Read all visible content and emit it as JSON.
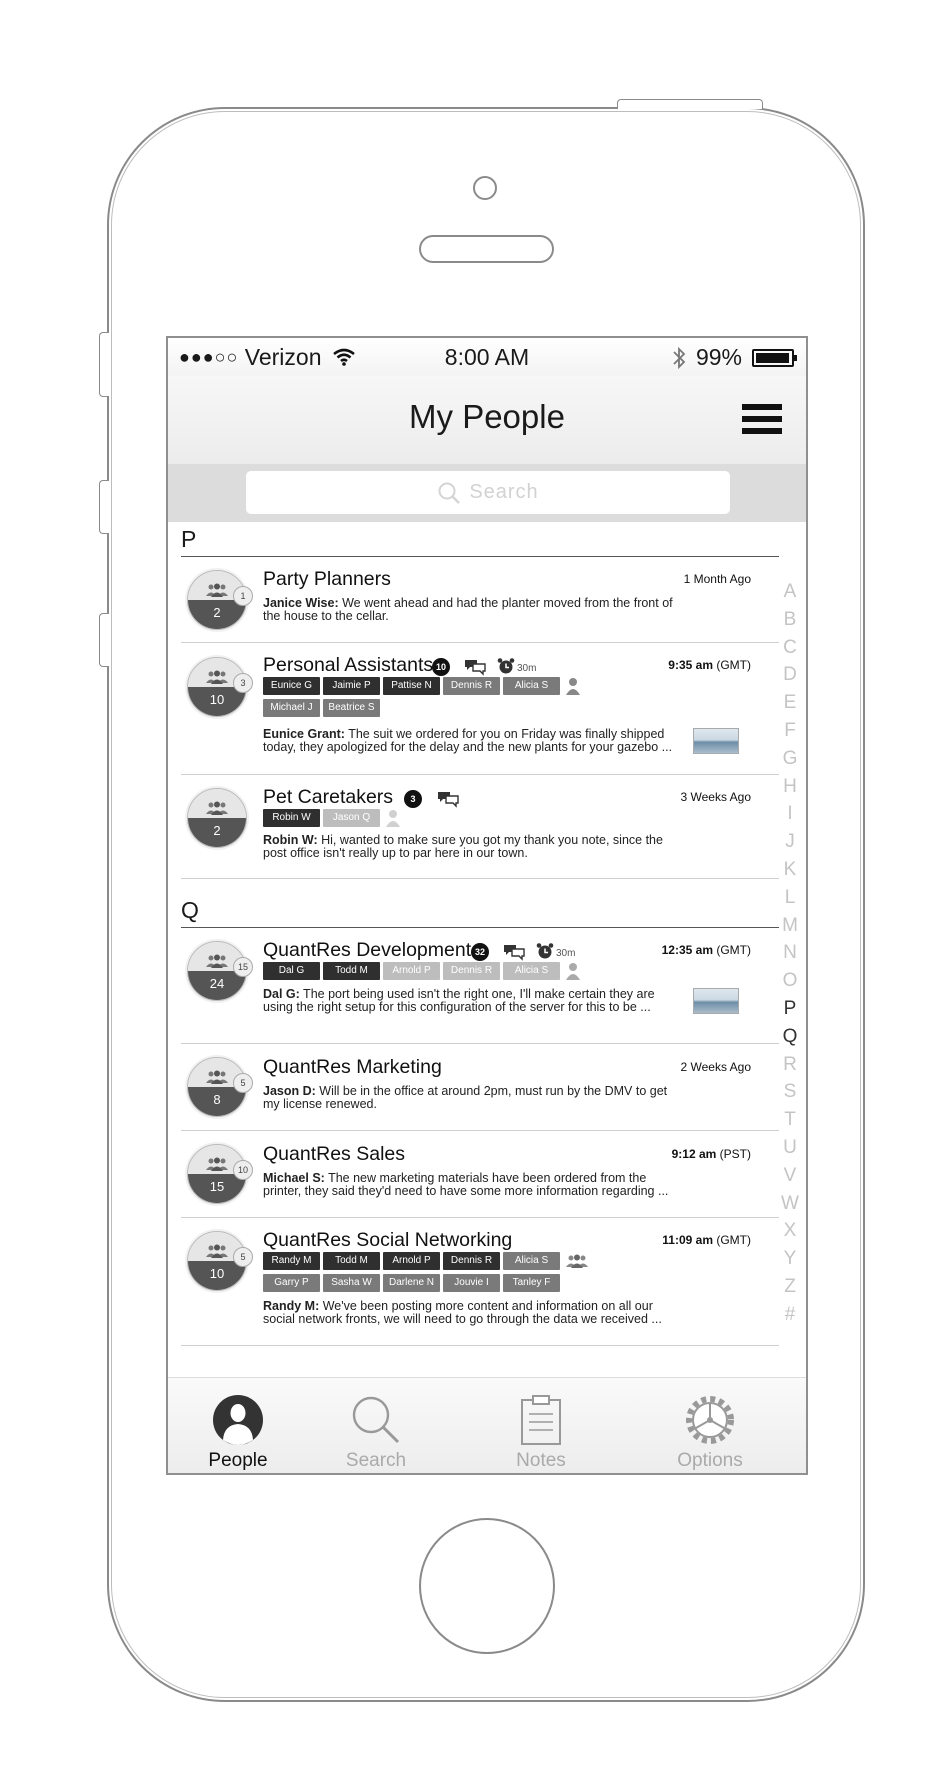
{
  "status_bar": {
    "signal": "●●●○○",
    "carrier": "Verizon",
    "time": "8:00 AM",
    "battery": "99%",
    "battery_level": 0.99
  },
  "header": {
    "title": "My People",
    "menu_icon": "hamburger-menu-icon"
  },
  "search": {
    "placeholder": "Search"
  },
  "sections": [
    {
      "letter": "P",
      "groups": [
        {
          "name": "Party Planners",
          "member_count": "2",
          "badge": "1",
          "time": "1 Month Ago",
          "sender": "Janice Wise:",
          "message": " We went ahead and had the planter moved from the front of the house to the cellar."
        },
        {
          "name": "Personal Assistants",
          "member_count": "10",
          "badge": "3",
          "unread": "10",
          "reminder": "30m",
          "time_bold": "9:35 am",
          "time_zone": " (GMT)",
          "tags_row1": [
            {
              "label": "Eunice G",
              "style": "dark"
            },
            {
              "label": "Jaimie P",
              "style": "dark"
            },
            {
              "label": "Pattise N",
              "style": "dark"
            },
            {
              "label": "Dennis R",
              "style": "mid"
            },
            {
              "label": "Alicia S",
              "style": "mid"
            }
          ],
          "tags_row2": [
            {
              "label": "Michael J",
              "style": "mid"
            },
            {
              "label": "Beatrice S",
              "style": "mid"
            }
          ],
          "sender": "Eunice Grant:",
          "message": " The suit we ordered for you on Friday was finally shipped today, they apologized for the delay and the new plants for your gazebo ..."
        },
        {
          "name": "Pet Caretakers",
          "member_count": "2",
          "unread": "3",
          "time": "3 Weeks Ago",
          "tags_row1": [
            {
              "label": "Robin W",
              "style": "dark"
            },
            {
              "label": "Jason Q",
              "style": "light"
            }
          ],
          "sender": "Robin W:",
          "message": " Hi, wanted to make sure you got my thank you note, since the post office isn't really up to par here in our town."
        }
      ]
    },
    {
      "letter": "Q",
      "groups": [
        {
          "name": "QuantRes Development",
          "member_count": "24",
          "badge": "15",
          "unread": "32",
          "reminder": "30m",
          "time_bold": "12:35 am",
          "time_zone": " (GMT)",
          "tags_row1": [
            {
              "label": "Dal G",
              "style": "dark"
            },
            {
              "label": "Todd M",
              "style": "dark"
            },
            {
              "label": "Arnold P",
              "style": "light"
            },
            {
              "label": "Dennis R",
              "style": "light"
            },
            {
              "label": "Alicia S",
              "style": "light"
            }
          ],
          "sender": "Dal G:",
          "message": " The port being used isn't the right one, I'll make certain they are using the right setup for this configuration of the server for this to be ..."
        },
        {
          "name": "QuantRes Marketing",
          "member_count": "8",
          "badge": "5",
          "time": "2 Weeks Ago",
          "sender": "Jason D:",
          "message": " Will be in the office at around 2pm, must run by the DMV to get my license renewed."
        },
        {
          "name": "QuantRes Sales",
          "member_count": "15",
          "badge": "10",
          "time_bold": "9:12 am",
          "time_zone": " (PST)",
          "sender": "Michael S:",
          "message": " The new marketing materials have been ordered from the printer, they said they'd need to have some more information regarding ..."
        },
        {
          "name": "QuantRes Social Networking",
          "member_count": "10",
          "badge": "5",
          "time_bold": "11:09 am",
          "time_zone": " (GMT)",
          "tags_row1": [
            {
              "label": "Randy M",
              "style": "dark"
            },
            {
              "label": "Todd M",
              "style": "dark"
            },
            {
              "label": "Arnold P",
              "style": "dark"
            },
            {
              "label": "Dennis R",
              "style": "dark"
            },
            {
              "label": "Alicia S",
              "style": "mid"
            }
          ],
          "tags_row2": [
            {
              "label": "Garry P",
              "style": "mid"
            },
            {
              "label": "Sasha W",
              "style": "mid"
            },
            {
              "label": "Darlene N",
              "style": "mid"
            },
            {
              "label": "Jouvie I",
              "style": "mid"
            },
            {
              "label": "Tanley F",
              "style": "mid"
            }
          ],
          "sender": "Randy M:",
          "message": " We've been posting more content and information on all our social network fronts, we will need to go through the data we received ..."
        }
      ]
    }
  ],
  "index_letters": [
    "A",
    "B",
    "C",
    "D",
    "E",
    "F",
    "G",
    "H",
    "I",
    "J",
    "K",
    "L",
    "M",
    "N",
    "O",
    "P",
    "Q",
    "R",
    "S",
    "T",
    "U",
    "V",
    "W",
    "X",
    "Y",
    "Z",
    "#"
  ],
  "active_index": [
    "P",
    "Q"
  ],
  "tabs": [
    {
      "label": "People",
      "icon": "person-silhouette-icon",
      "active": true
    },
    {
      "label": "Search",
      "icon": "magnifier-icon",
      "active": false
    },
    {
      "label": "Notes",
      "icon": "clipboard-icon",
      "active": false
    },
    {
      "label": "Options",
      "icon": "gear-icon",
      "active": false
    }
  ],
  "colors": {
    "tag_dark": "#2f2f2f",
    "tag_mid": "#7a7a7a",
    "tag_light": "#bdbdbd",
    "active_text": "#111111",
    "inactive_text": "#aaaaaa"
  }
}
